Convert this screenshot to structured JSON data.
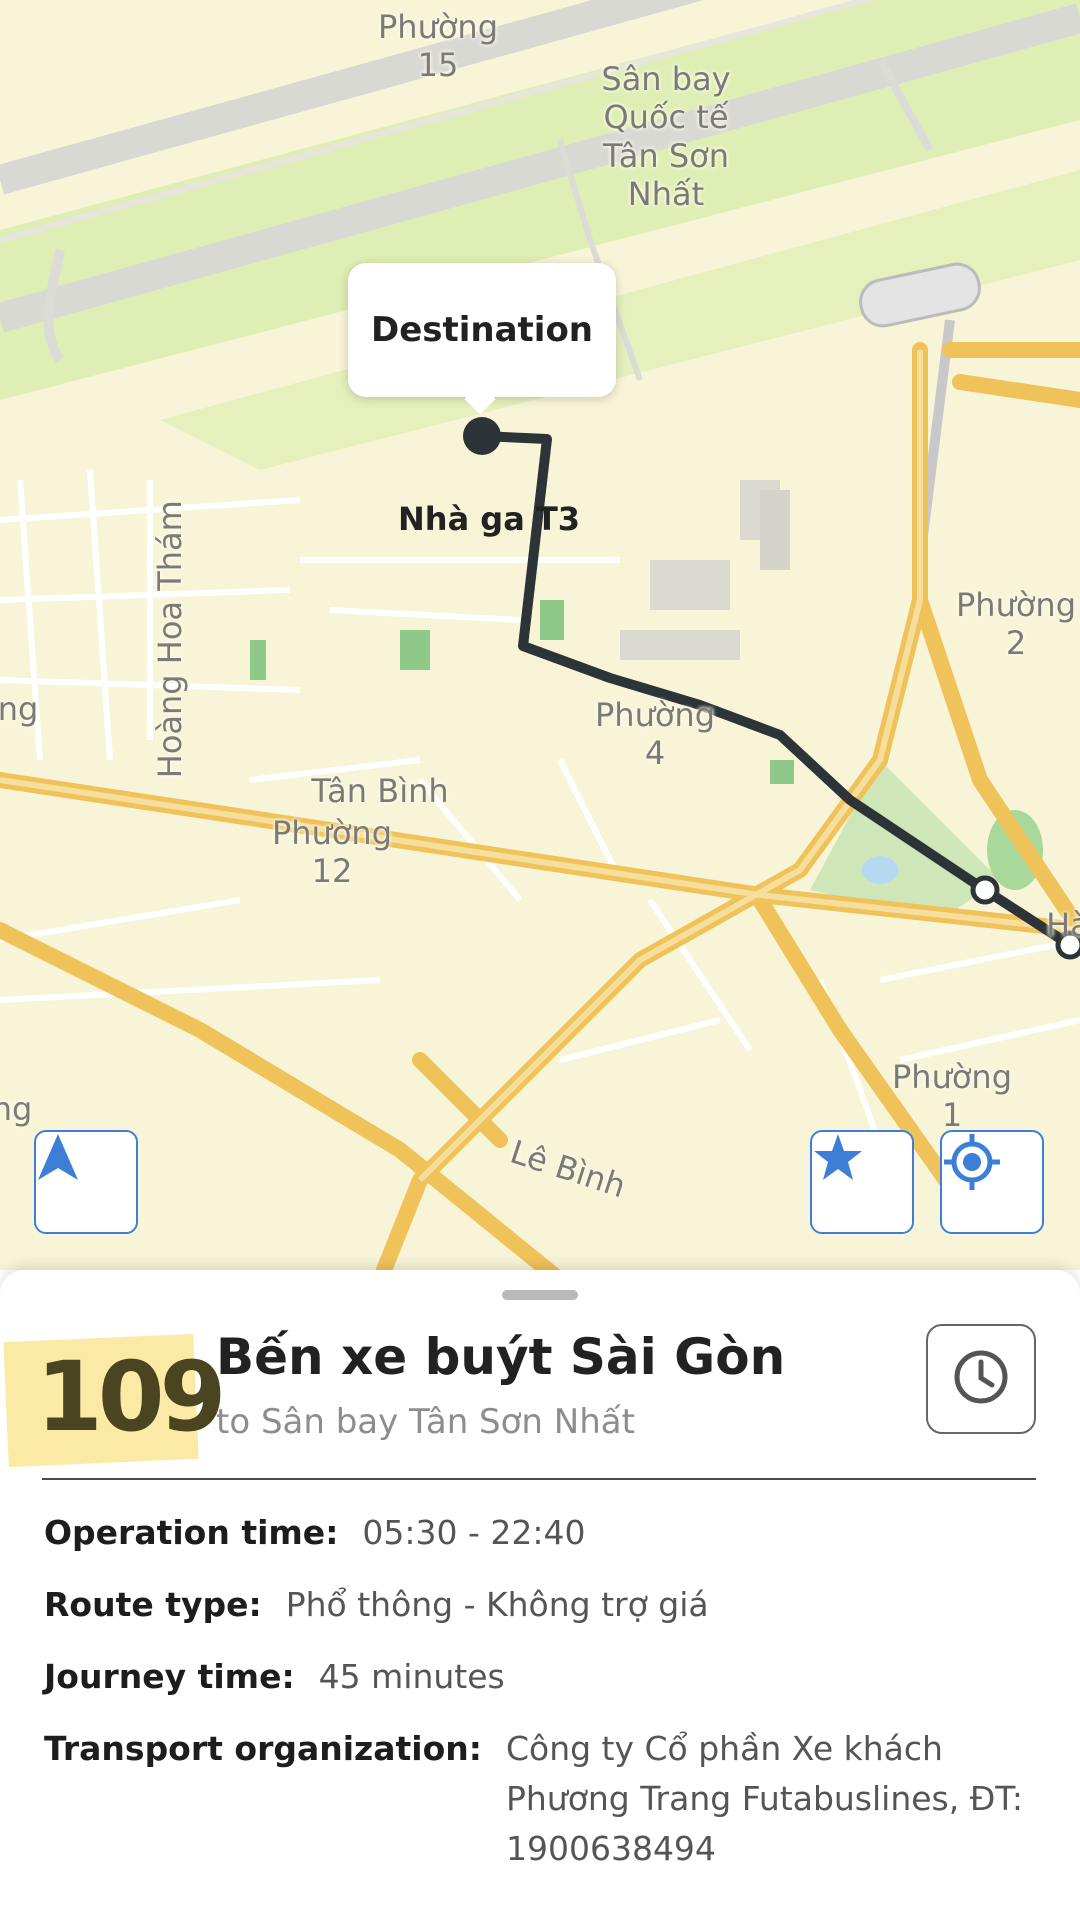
{
  "map": {
    "callout_text": "Destination",
    "poi_label": "Nhà ga T3",
    "labels": [
      {
        "text": "Phường\n15"
      },
      {
        "text": "Sân bay\nQuốc tế\nTân Sơn\nNhất"
      },
      {
        "text": "Hoàng Hoa Thám"
      },
      {
        "text": "Tân Bình"
      },
      {
        "text": "Phường\n12"
      },
      {
        "text": "Phường\n4"
      },
      {
        "text": "Phường\n2"
      },
      {
        "text": "Phường\n1"
      },
      {
        "text": "Lê Bình"
      },
      {
        "text": "ng"
      },
      {
        "text": "ng"
      },
      {
        "text": "Hà"
      }
    ],
    "route_color": "#2d3437",
    "accent_color": "#3d7fd6",
    "road_color": "#f0c25a"
  },
  "controls": {
    "navigate_icon": "navigation-arrow-icon",
    "favorite_icon": "star-icon",
    "locate_icon": "my-location-icon"
  },
  "route": {
    "number": "109",
    "title": "Bến xe buýt Sài Gòn",
    "subtitle": "to Sân bay Tân Sơn Nhất",
    "schedule_icon": "clock-icon",
    "details": [
      {
        "label": "Operation time:",
        "value": "05:30 - 22:40"
      },
      {
        "label": "Route type:",
        "value": "Phổ thông - Không trợ giá"
      },
      {
        "label": "Journey time:",
        "value": "45 minutes"
      },
      {
        "label": "Transport organization:",
        "value": "Công ty Cổ phần Xe khách Phương Trang Futabuslines, ĐT: 1900638494"
      }
    ]
  }
}
